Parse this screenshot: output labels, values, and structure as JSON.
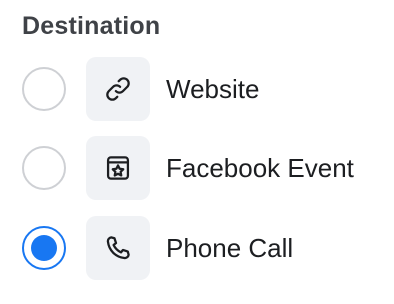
{
  "destination": {
    "title": "Destination",
    "accent_color": "#1877f2",
    "options": [
      {
        "label": "Website",
        "icon": "link-icon",
        "selected": false
      },
      {
        "label": "Facebook Event",
        "icon": "calendar-star-icon",
        "selected": false
      },
      {
        "label": "Phone Call",
        "icon": "phone-icon",
        "selected": true
      }
    ]
  }
}
